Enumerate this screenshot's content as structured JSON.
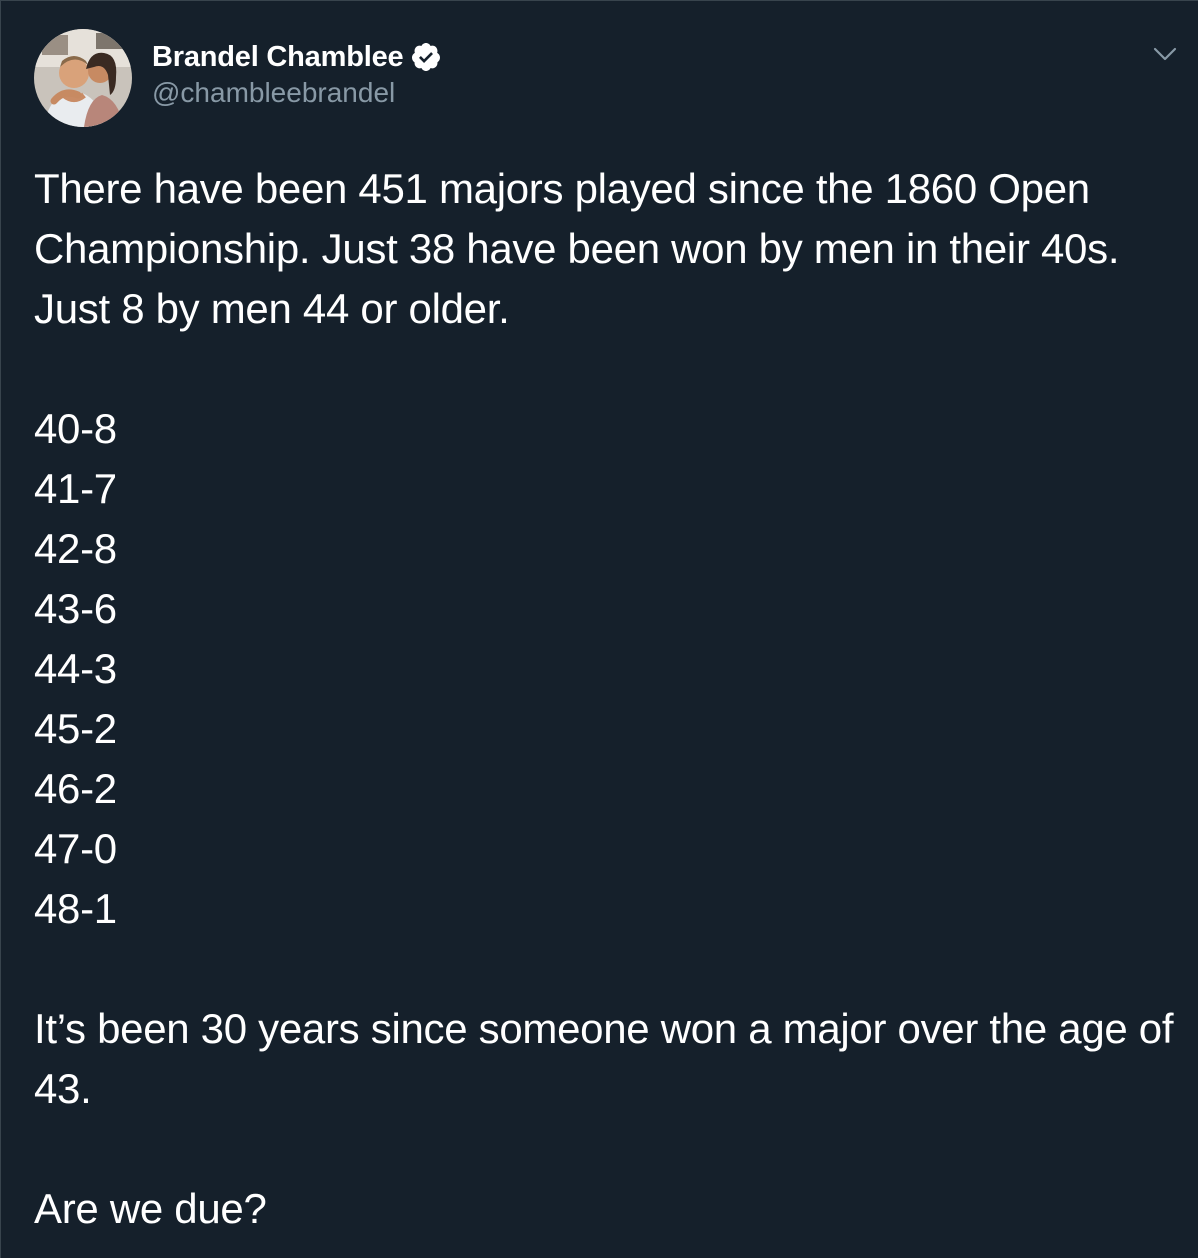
{
  "author": {
    "display_name": "Brandel Chamblee",
    "handle": "@chambleebrandel",
    "verified": true,
    "avatar_icon": "profile-photo"
  },
  "tweet": {
    "intro": "There have been 451 majors played since the 1860 Open Championship. Just 38 have been won by men in their 40s. Just 8 by men 44 or older.",
    "stats": [
      "40-8",
      "41-7",
      "42-8",
      "43-6",
      "44-3",
      "45-2",
      "46-2",
      "47-0",
      "48-1"
    ],
    "conclusion": "It’s been 30 years since someone won a major over the age of 43.",
    "question": "Are we due?"
  },
  "icons": {
    "verified": "verified-badge-icon",
    "menu": "chevron-down-icon"
  },
  "colors": {
    "background": "#15202b",
    "text": "#ffffff",
    "secondary_text": "#8899a6",
    "verified_badge": "#ffffff"
  }
}
